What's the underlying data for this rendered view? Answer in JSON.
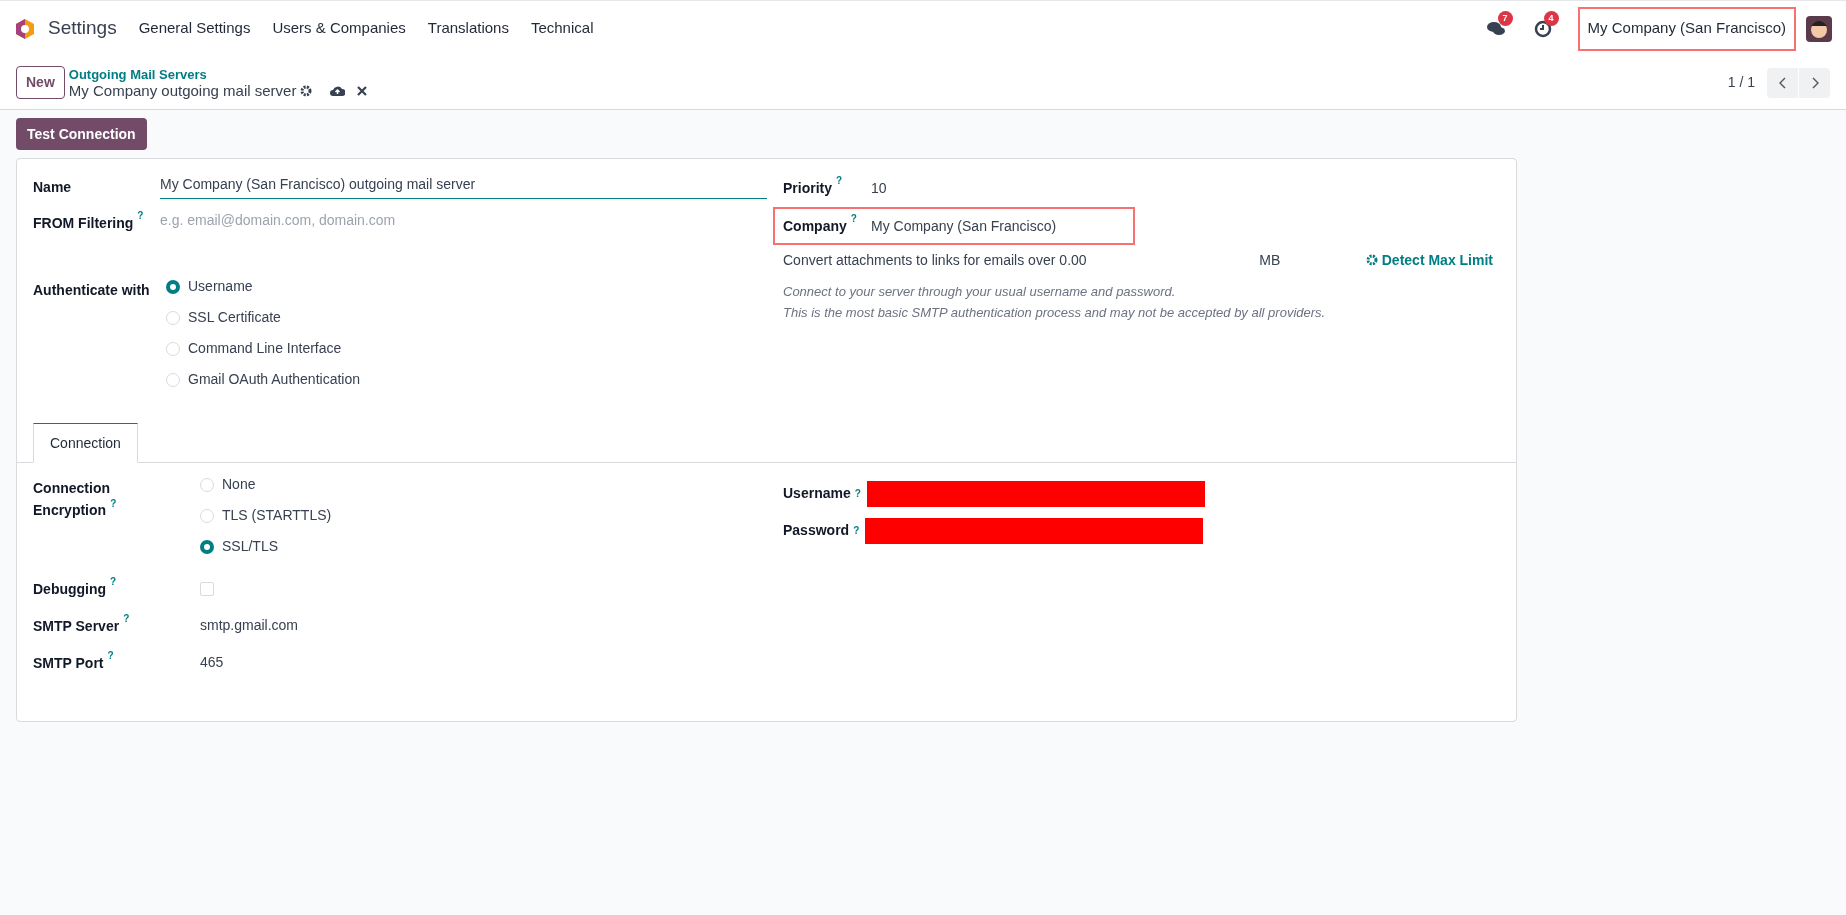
{
  "navbar": {
    "app": "Settings",
    "menus": [
      "General Settings",
      "Users & Companies",
      "Translations",
      "Technical"
    ],
    "messages_badge": "7",
    "activities_badge": "4",
    "company": {
      "label": "My Company (San Francisco)",
      "highlighted": true
    }
  },
  "control_panel": {
    "new_button": "New",
    "breadcrumb": "Outgoing Mail Servers",
    "record": "My Company outgoing mail server",
    "pager": "1 / 1"
  },
  "actions": [
    "Test Connection"
  ],
  "form": {
    "left": [
      {
        "kind": "text",
        "label": "Name",
        "value": "My Company (San Francisco) outgoing mail server",
        "focused": true
      },
      {
        "kind": "text",
        "label": "FROM Filtering",
        "help": "?",
        "placeholder": "e.g. email@domain.com, domain.com",
        "focused": false
      }
    ],
    "authenticate": {
      "label": "Authenticate with",
      "options": [
        {
          "label": "Username",
          "selected": true
        },
        {
          "label": "SSL Certificate",
          "selected": false
        },
        {
          "label": "Command Line Interface",
          "selected": false
        },
        {
          "label": "Gmail OAuth Authentication",
          "selected": false
        }
      ]
    },
    "right": [
      {
        "label": "Priority",
        "help": "?",
        "value": "10",
        "highlighted": false
      },
      {
        "label": "Company",
        "help": "?",
        "value": "My Company (San Francisco)",
        "highlighted": true
      }
    ],
    "attachments": {
      "label": "Convert attachments to links for emails over",
      "value": "0.00",
      "unit": "MB",
      "button": "Detect Max Limit"
    },
    "hint": [
      "Connect to your server through your usual username and password.",
      "This is the most basic SMTP authentication process and may not be accepted by all providers."
    ],
    "tabs": [
      {
        "label": "Connection",
        "selected": true
      }
    ],
    "encryption": {
      "label": "Connection Encryption",
      "help": "?",
      "options": [
        {
          "label": "None",
          "selected": false
        },
        {
          "label": "TLS (STARTTLS)",
          "selected": false
        },
        {
          "label": "SSL/TLS",
          "selected": true
        }
      ]
    },
    "debugging": {
      "label": "Debugging",
      "help": "?",
      "checked": false
    },
    "connection_fields": [
      {
        "label": "SMTP Server",
        "help": "?",
        "value": "smtp.gmail.com"
      },
      {
        "label": "SMTP Port",
        "help": "?",
        "value": "465"
      }
    ],
    "credentials": [
      {
        "label": "Username",
        "help": "?",
        "redacted": true
      },
      {
        "label": "Password",
        "help": "?",
        "redacted": true
      }
    ]
  }
}
